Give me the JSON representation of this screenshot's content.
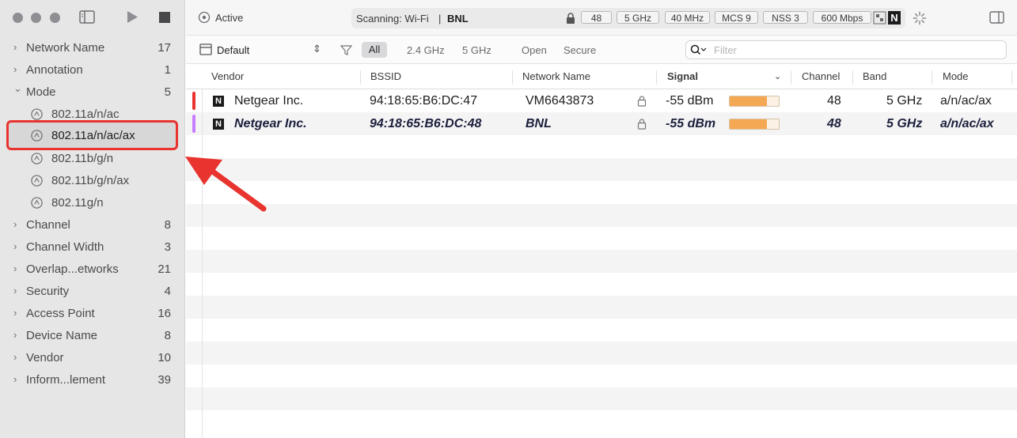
{
  "toolbar": {
    "active_label": "Active",
    "scanning_label": "Scanning: Wi-Fi",
    "scanning_network": "BNL",
    "chips": [
      "48",
      "5 GHz",
      "40 MHz",
      "MCS 9",
      "NSS 3",
      "600 Mbps"
    ],
    "vendor_badge": "N"
  },
  "sidebar": {
    "items": [
      {
        "label": "Network Name",
        "count": "17"
      },
      {
        "label": "Annotation",
        "count": "1"
      },
      {
        "label": "Mode",
        "count": "5",
        "expanded": true,
        "children": [
          "802.11a/n/ac",
          "802.11a/n/ac/ax",
          "802.11b/g/n",
          "802.11b/g/n/ax",
          "802.11g/n"
        ]
      },
      {
        "label": "Channel",
        "count": "8"
      },
      {
        "label": "Channel Width",
        "count": "3"
      },
      {
        "label": "Overlap...etworks",
        "count": "21"
      },
      {
        "label": "Security",
        "count": "4"
      },
      {
        "label": "Access Point",
        "count": "16"
      },
      {
        "label": "Device Name",
        "count": "8"
      },
      {
        "label": "Vendor",
        "count": "10"
      },
      {
        "label": "Inform...lement",
        "count": "39"
      }
    ],
    "selected_child": "802.11a/n/ac/ax"
  },
  "filterbar": {
    "preset": "Default",
    "segments": [
      "All",
      "2.4 GHz",
      "5 GHz",
      "Open",
      "Secure"
    ],
    "selected_segment": "All",
    "filter_placeholder": "Filter"
  },
  "table": {
    "columns": [
      "Vendor",
      "BSSID",
      "Network Name",
      "Signal",
      "Channel",
      "Band",
      "Mode"
    ],
    "rows": [
      {
        "vendor": "Netgear Inc.",
        "bssid": "94:18:65:B6:DC:47",
        "network": "VM6643873",
        "signal": "-55 dBm",
        "signal_level": 0.75,
        "channel": "48",
        "band": "5 GHz",
        "mode": "a/n/ac/ax",
        "color": "#e8332f",
        "bold": false
      },
      {
        "vendor": "Netgear Inc.",
        "bssid": "94:18:65:B6:DC:48",
        "network": "BNL",
        "signal": "-55 dBm",
        "signal_level": 0.75,
        "channel": "48",
        "band": "5 GHz",
        "mode": "a/n/ac/ax",
        "color": "#c77dff",
        "bold": true
      }
    ]
  },
  "colors": {
    "accent_red": "#e8332f",
    "signal_fill": "#f5a853"
  }
}
